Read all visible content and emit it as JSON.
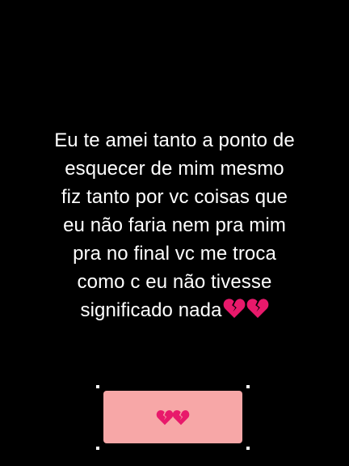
{
  "quote": {
    "lines": [
      "Eu te amei tanto a ponto de",
      "esquecer de mim mesmo",
      "fiz tanto por vc coisas que",
      "eu não faria nem pra mim",
      "pra no final vc me troca",
      "como c eu não tivesse",
      "significado nada"
    ],
    "trailing_emoji": [
      "broken-heart-emoji",
      "broken-heart-emoji"
    ]
  },
  "sticker": {
    "emoji": [
      "broken-heart-emoji",
      "broken-heart-emoji"
    ]
  },
  "colors": {
    "background": "#000000",
    "text": "#ffffff",
    "sticker_background": "#f7a7a7",
    "heart": "#e8196b"
  }
}
